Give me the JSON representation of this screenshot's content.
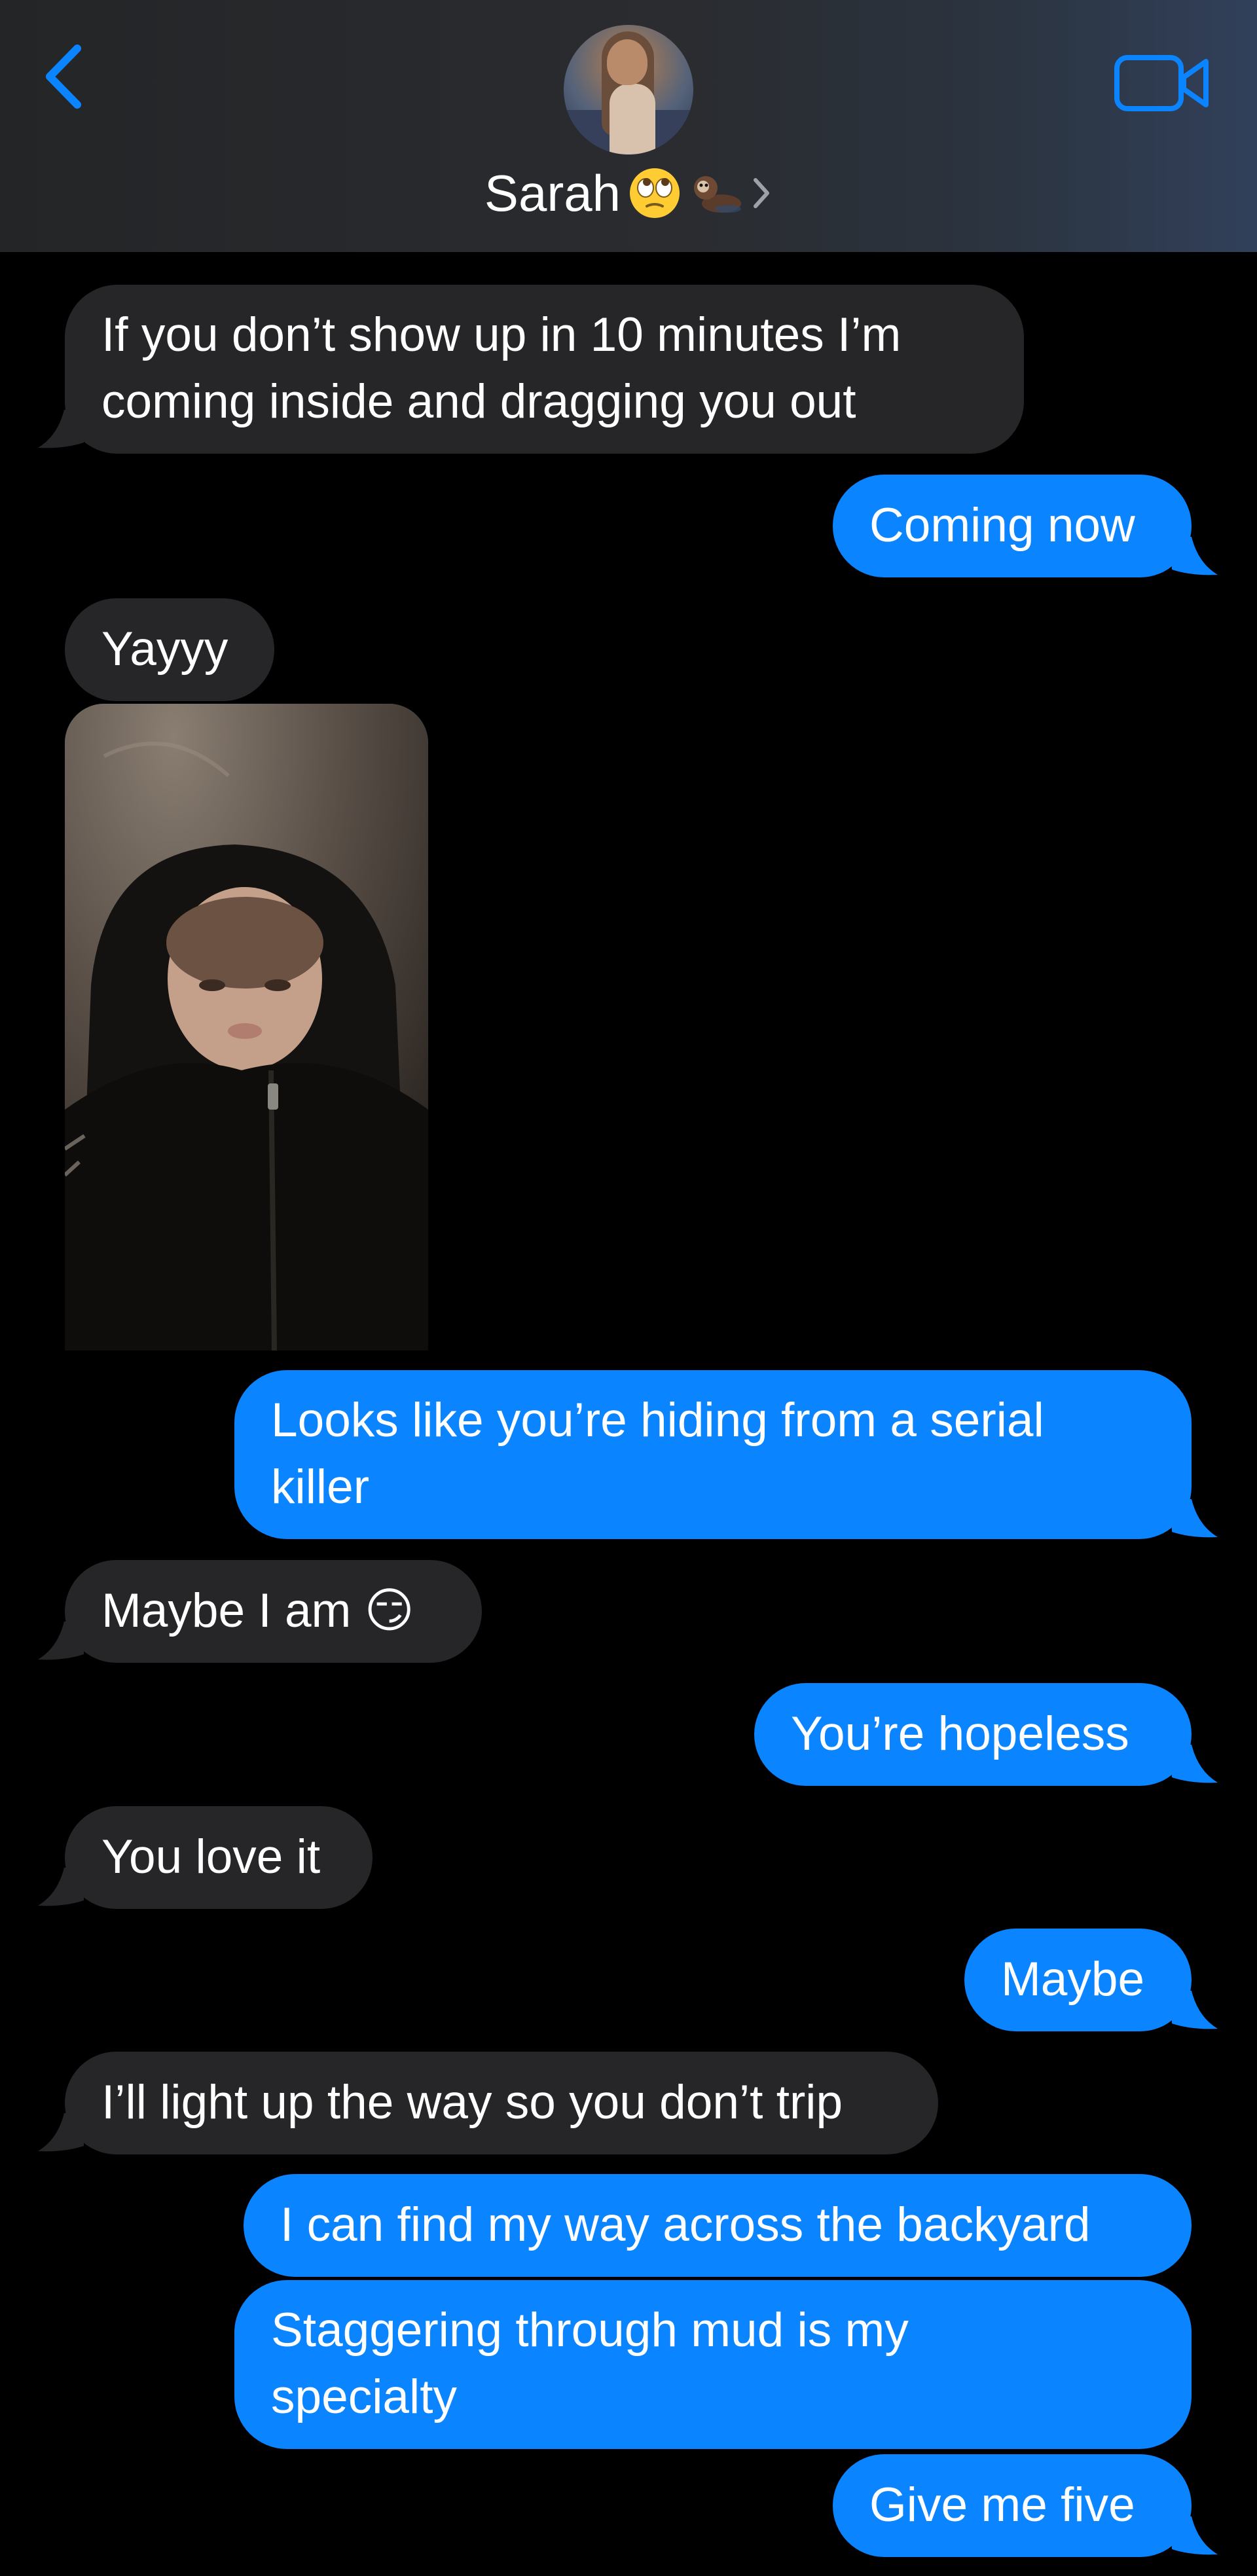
{
  "header": {
    "contact_name": "Sarah",
    "contact_emoji": [
      "🙄",
      "🦦"
    ],
    "accent_color": "#0a84ff",
    "back_icon": "chevron-left-icon",
    "video_icon": "video-camera-icon",
    "chevron_icon": "chevron-right-icon"
  },
  "messages": [
    {
      "direction": "incoming",
      "text": "If you don’t show up in 10 minutes I’m\ncoming inside and dragging you out"
    },
    {
      "direction": "outgoing",
      "text": "Coming now"
    },
    {
      "direction": "incoming",
      "text": "Yayyy"
    },
    {
      "direction": "incoming",
      "type": "photo"
    },
    {
      "direction": "outgoing",
      "text": "Looks like you’re hiding from a serial\nkiller"
    },
    {
      "direction": "incoming",
      "text": "Maybe I am 😏"
    },
    {
      "direction": "outgoing",
      "text": "You’re hopeless"
    },
    {
      "direction": "incoming",
      "text": "You love it"
    },
    {
      "direction": "outgoing",
      "text": "Maybe"
    },
    {
      "direction": "incoming",
      "text": "I’ll light up the way so you don’t trip"
    },
    {
      "direction": "outgoing",
      "text": "I can find my way across the backyard"
    },
    {
      "direction": "outgoing",
      "text": "Staggering through mud is my\nspecialty"
    },
    {
      "direction": "outgoing",
      "text": "Give me five"
    }
  ],
  "colors": {
    "incoming_bubble": "#262628",
    "outgoing_bubble": "#0a84ff",
    "background": "#000000"
  }
}
